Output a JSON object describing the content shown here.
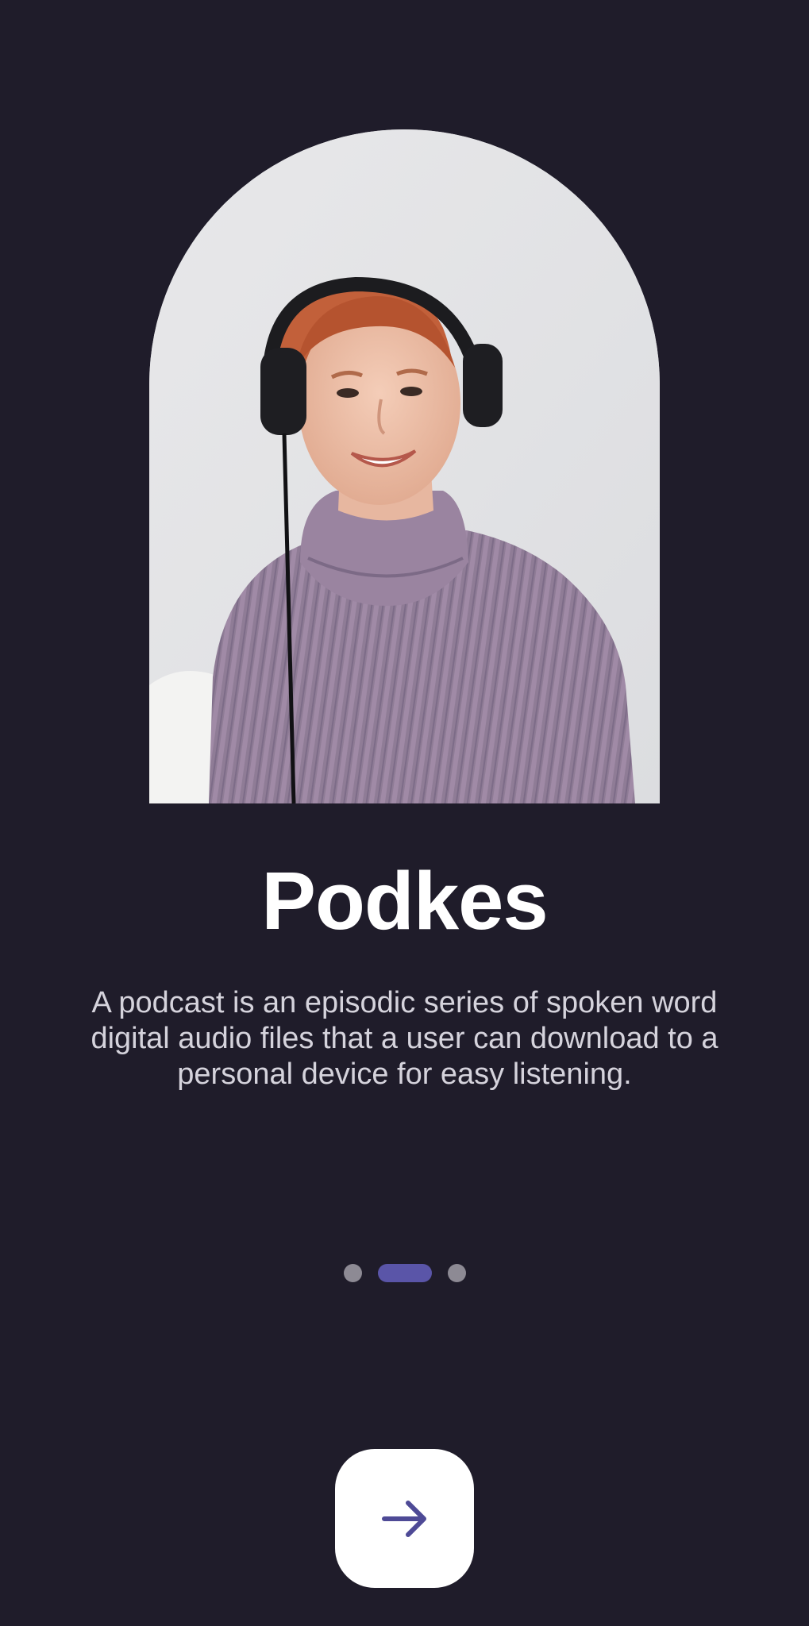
{
  "onboarding": {
    "title": "Podkes",
    "description": "A podcast is an episodic series of spoken word digital audio files that a user can download to a personal device for easy listening.",
    "pager": {
      "total_pages": 3,
      "active_page": 2
    },
    "next_icon": "arrow-right-icon"
  },
  "colors": {
    "background": "#1f1c2a",
    "accent": "#5a55a8",
    "inactive_dot": "#8d8a94",
    "button_bg": "#ffffff"
  }
}
